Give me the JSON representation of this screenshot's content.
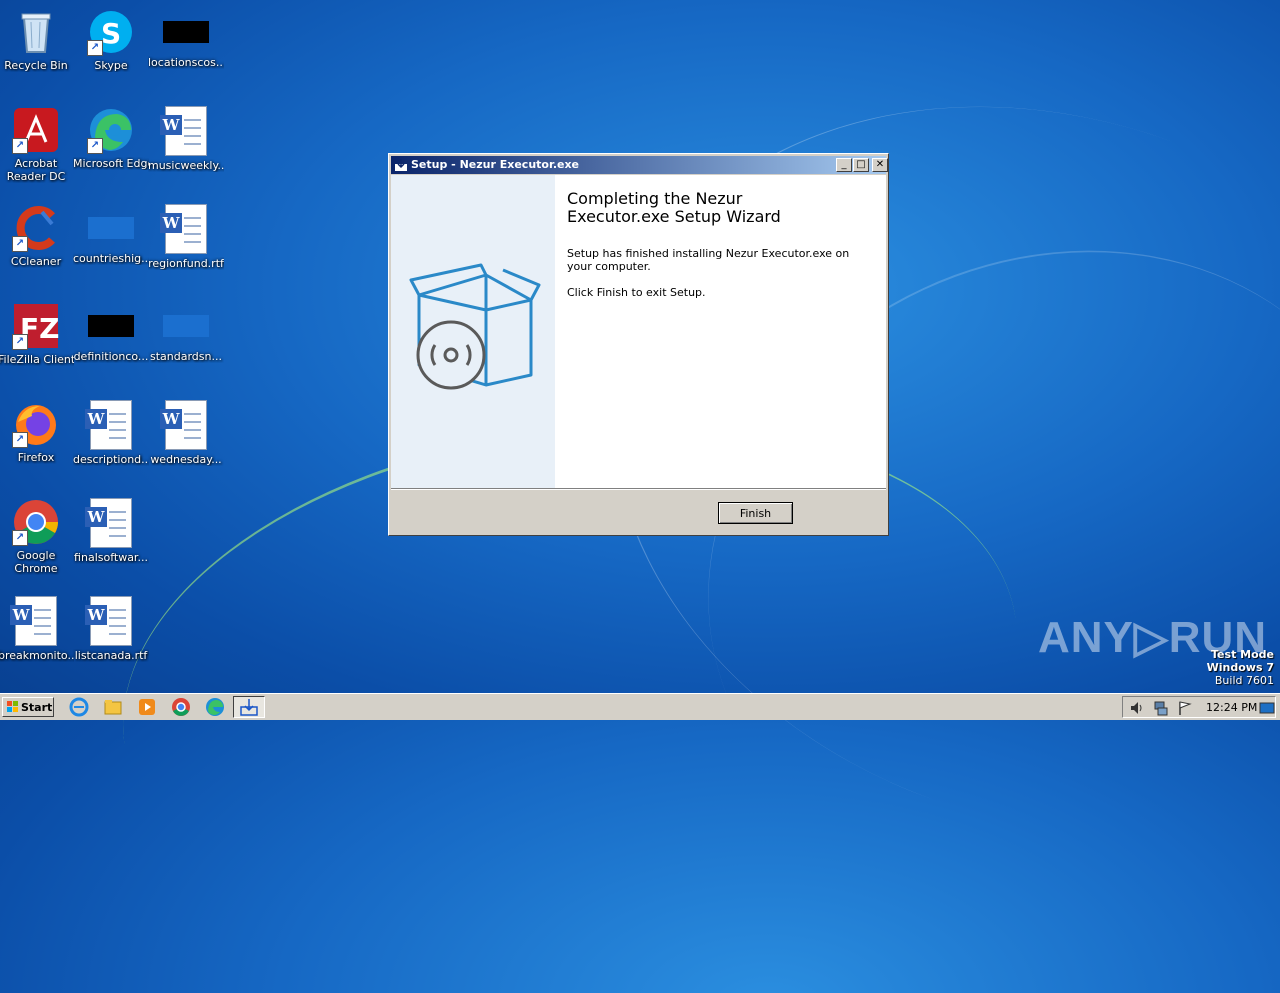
{
  "desktop": {
    "icons": [
      {
        "label": "Recycle Bin"
      },
      {
        "label": "Skype"
      },
      {
        "label": "locationscos..."
      },
      {
        "label": "Acrobat Reader DC"
      },
      {
        "label": "Microsoft Edge"
      },
      {
        "label": "musicweekly..."
      },
      {
        "label": "CCleaner"
      },
      {
        "label": "countrieshig..."
      },
      {
        "label": "regionfund.rtf"
      },
      {
        "label": "FileZilla Client"
      },
      {
        "label": "definitionco..."
      },
      {
        "label": "standardsn..."
      },
      {
        "label": "Firefox"
      },
      {
        "label": "descriptiond..."
      },
      {
        "label": "wednesday..."
      },
      {
        "label": "Google Chrome"
      },
      {
        "label": "finalsoftwar..."
      },
      {
        "label": "breakmonito..."
      },
      {
        "label": "listcanada.rtf"
      }
    ]
  },
  "window": {
    "title": "Setup - Nezur Executor.exe",
    "heading": "Completing the Nezur Executor.exe Setup Wizard",
    "message1": "Setup has finished installing Nezur Executor.exe on your computer.",
    "message2": "Click Finish to exit Setup.",
    "finish_label": "Finish",
    "minimize_glyph": "_",
    "maximize_glyph": "□",
    "close_glyph": "✕"
  },
  "taskbar": {
    "start_label": "Start",
    "clock": "12:24 PM"
  },
  "watermark": {
    "line1": "Test Mode",
    "line2": "Windows 7",
    "line3": "Build 7601",
    "brand": "ANY▷RUN"
  }
}
